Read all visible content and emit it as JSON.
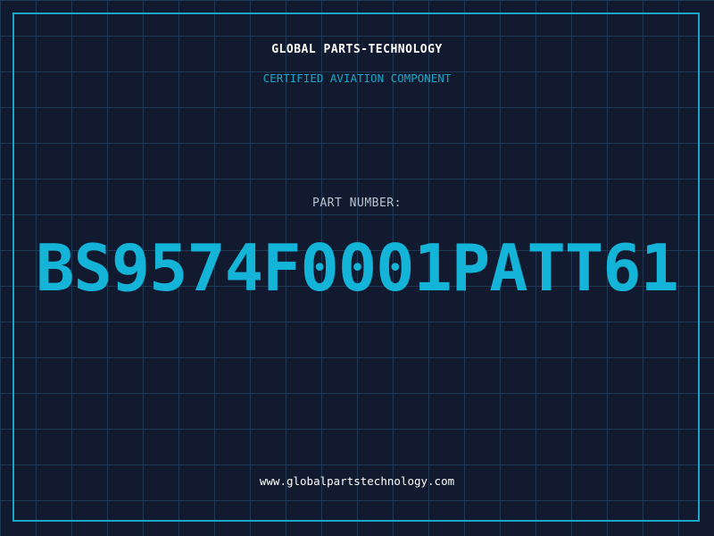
{
  "header": {
    "company": "GLOBAL PARTS-TECHNOLOGY",
    "subtitle": "CERTIFIED AVIATION COMPONENT"
  },
  "part": {
    "label": "PART NUMBER:",
    "number": "BS9574F0001PATT61"
  },
  "footer": {
    "website": "www.globalpartstechnology.com"
  },
  "colors": {
    "background": "#111a2e",
    "grid": "#1f3a52",
    "accent": "#14b4d8",
    "frame": "#1aa6c8"
  }
}
